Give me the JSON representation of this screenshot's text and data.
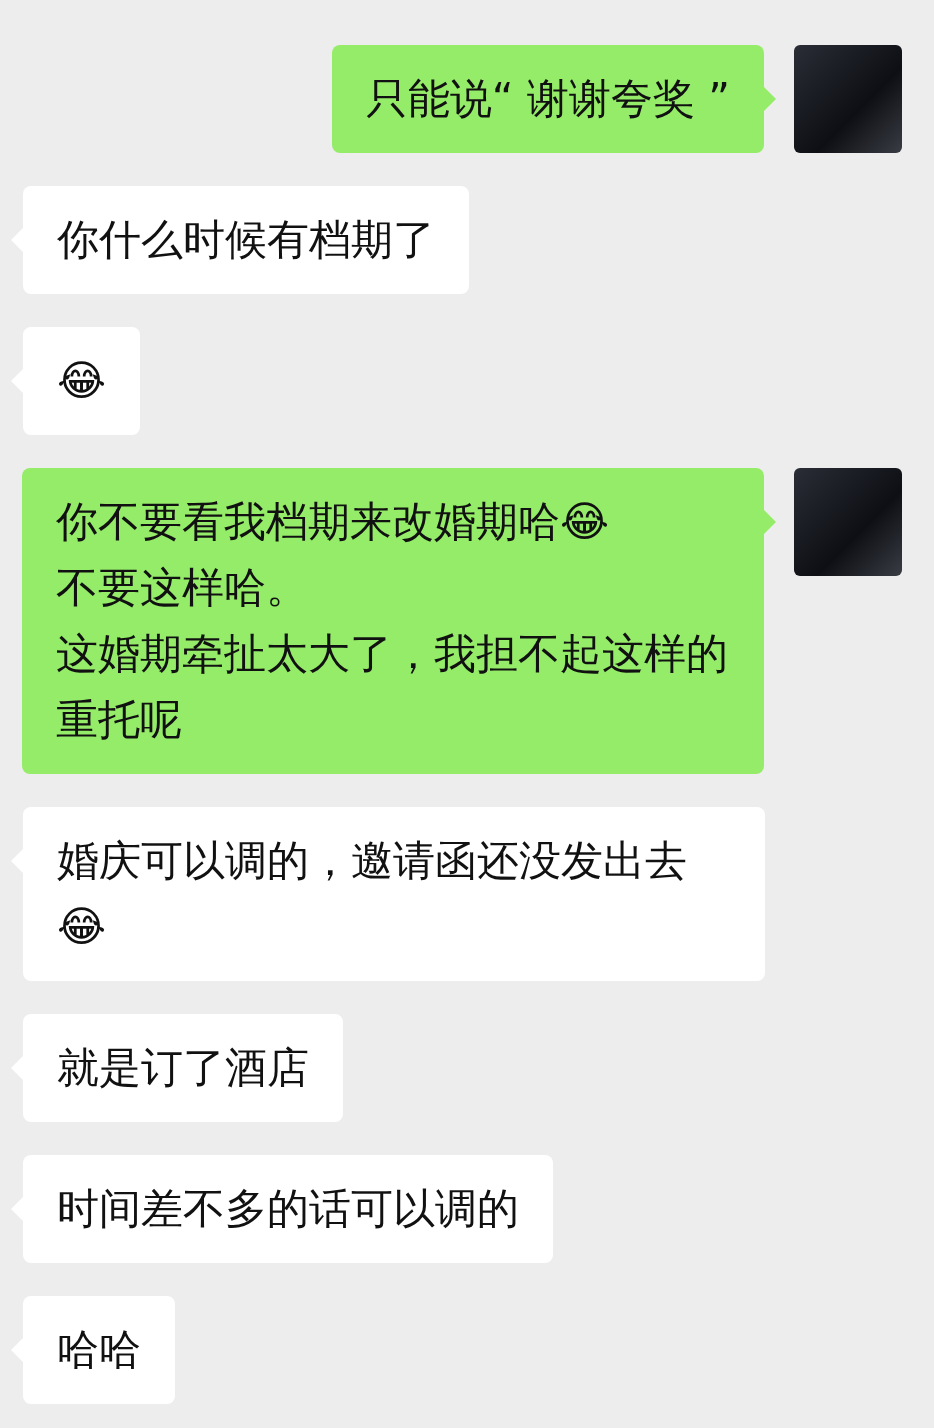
{
  "messages": [
    {
      "kind": "sent",
      "lines": [
        "只能说“ 谢谢夸奖 ”"
      ]
    },
    {
      "kind": "received",
      "lines": [
        "你什么时候有档期了"
      ]
    },
    {
      "kind": "received",
      "lines": [
        "😂"
      ]
    },
    {
      "kind": "sent",
      "lines": [
        "你不要看我档期来改婚期哈😂",
        "不要这样哈。",
        "这婚期牵扯太大了，我担不起这样的重托呢"
      ]
    },
    {
      "kind": "received",
      "lines": [
        "婚庆可以调的，邀请函还没发出去😂"
      ]
    },
    {
      "kind": "received",
      "lines": [
        "就是订了酒店"
      ]
    },
    {
      "kind": "received",
      "lines": [
        "时间差不多的话可以调的"
      ]
    },
    {
      "kind": "received",
      "lines": [
        "哈哈"
      ]
    }
  ]
}
